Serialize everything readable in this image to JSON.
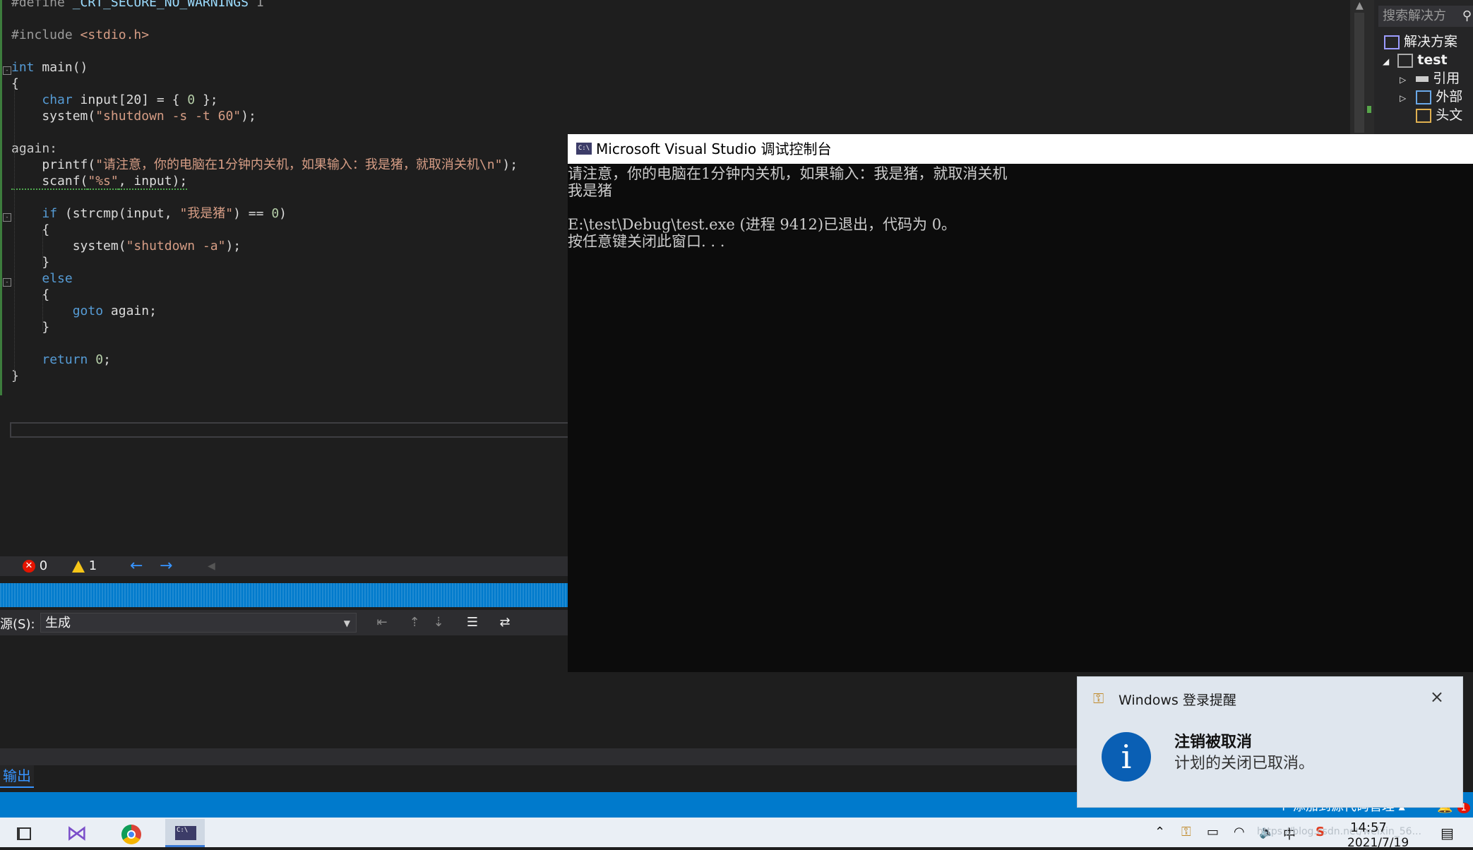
{
  "editor": {
    "lines": [
      [
        {
          "t": "#define ",
          "c": "pp"
        },
        {
          "t": "_CRT_SECURE_NO_WARNINGS",
          "c": "var"
        },
        {
          "t": " 1",
          "c": "pp"
        }
      ],
      [],
      [
        {
          "t": "#include ",
          "c": "pp"
        },
        {
          "t": "<stdio.h>",
          "c": "str"
        }
      ],
      [],
      [
        {
          "t": "int",
          "c": "kw"
        },
        {
          "t": " main()",
          "c": "plain"
        }
      ],
      [
        {
          "t": "{",
          "c": "plain"
        }
      ],
      [
        {
          "t": "    ",
          "c": "plain"
        },
        {
          "t": "char",
          "c": "kw"
        },
        {
          "t": " input[20] = { ",
          "c": "plain"
        },
        {
          "t": "0",
          "c": "num"
        },
        {
          "t": " };",
          "c": "plain"
        }
      ],
      [
        {
          "t": "    system(",
          "c": "plain"
        },
        {
          "t": "\"shutdown -s -t 60\"",
          "c": "str"
        },
        {
          "t": ");",
          "c": "plain"
        }
      ],
      [],
      [
        {
          "t": "again:",
          "c": "label"
        }
      ],
      [
        {
          "t": "    printf(",
          "c": "plain"
        },
        {
          "t": "\"请注意，你的电脑在1分钟内关机，如果输入：我是猪，就取消关机\\n\"",
          "c": "str"
        },
        {
          "t": ");",
          "c": "plain"
        }
      ],
      [
        {
          "t": "    scanf(",
          "c": "plain",
          "sq": true
        },
        {
          "t": "\"%s\"",
          "c": "str",
          "sq": true
        },
        {
          "t": ", input);",
          "c": "plain",
          "sq": true
        }
      ],
      [],
      [
        {
          "t": "    ",
          "c": "plain"
        },
        {
          "t": "if",
          "c": "kw"
        },
        {
          "t": " (strcmp(input, ",
          "c": "plain"
        },
        {
          "t": "\"我是猪\"",
          "c": "str"
        },
        {
          "t": ") == ",
          "c": "plain"
        },
        {
          "t": "0",
          "c": "num"
        },
        {
          "t": ")",
          "c": "plain"
        }
      ],
      [
        {
          "t": "    {",
          "c": "plain"
        }
      ],
      [
        {
          "t": "        system(",
          "c": "plain"
        },
        {
          "t": "\"shutdown -a\"",
          "c": "str"
        },
        {
          "t": ");",
          "c": "plain"
        }
      ],
      [
        {
          "t": "    }",
          "c": "plain"
        }
      ],
      [
        {
          "t": "    ",
          "c": "plain"
        },
        {
          "t": "else",
          "c": "kw"
        }
      ],
      [
        {
          "t": "    {",
          "c": "plain"
        }
      ],
      [
        {
          "t": "        ",
          "c": "plain"
        },
        {
          "t": "goto",
          "c": "kw"
        },
        {
          "t": " again;",
          "c": "plain"
        }
      ],
      [
        {
          "t": "    }",
          "c": "plain"
        }
      ],
      [],
      [
        {
          "t": "    ",
          "c": "plain"
        },
        {
          "t": "return",
          "c": "kw"
        },
        {
          "t": " ",
          "c": "plain"
        },
        {
          "t": "0",
          "c": "num"
        },
        {
          "t": ";",
          "c": "plain"
        }
      ],
      [
        {
          "t": "}",
          "c": "plain"
        }
      ]
    ]
  },
  "solution_explorer": {
    "search_placeholder": "搜索解决方",
    "items": [
      {
        "label": "解决方案"
      },
      {
        "label": "test"
      },
      {
        "label": "引用"
      },
      {
        "label": "外部"
      },
      {
        "label": "头文"
      }
    ]
  },
  "error_list": {
    "errors": "0",
    "warnings": "1"
  },
  "output_panel": {
    "source_label": "源(S):",
    "source_value": "生成",
    "tab_label": "输出"
  },
  "status_bar": {
    "source_control": "添加到源代码管理",
    "notifications": "1"
  },
  "console": {
    "title": "Microsoft Visual Studio 调试控制台",
    "icon_text": "C:\\",
    "output": "请注意，你的电脑在1分钟内关机，如果输入：我是猪，就取消关机\n我是猪\n\nE:\\test\\Debug\\test.exe (进程 9412)已退出，代码为 0。\n按任意键关闭此窗口. . ."
  },
  "toast": {
    "app": "Windows 登录提醒",
    "title": "注销被取消",
    "body": "计划的关闭已取消。",
    "icon_letter": "i"
  },
  "taskbar": {
    "time": "14:57",
    "date": "2021/7/19",
    "ime": "中",
    "watermark": "https://blog.csdn.net/weixin_56..."
  },
  "colors": {
    "accent": "#007acc",
    "editor_bg": "#1e1e1e",
    "keyword": "#569cd6",
    "string": "#d69d85"
  }
}
